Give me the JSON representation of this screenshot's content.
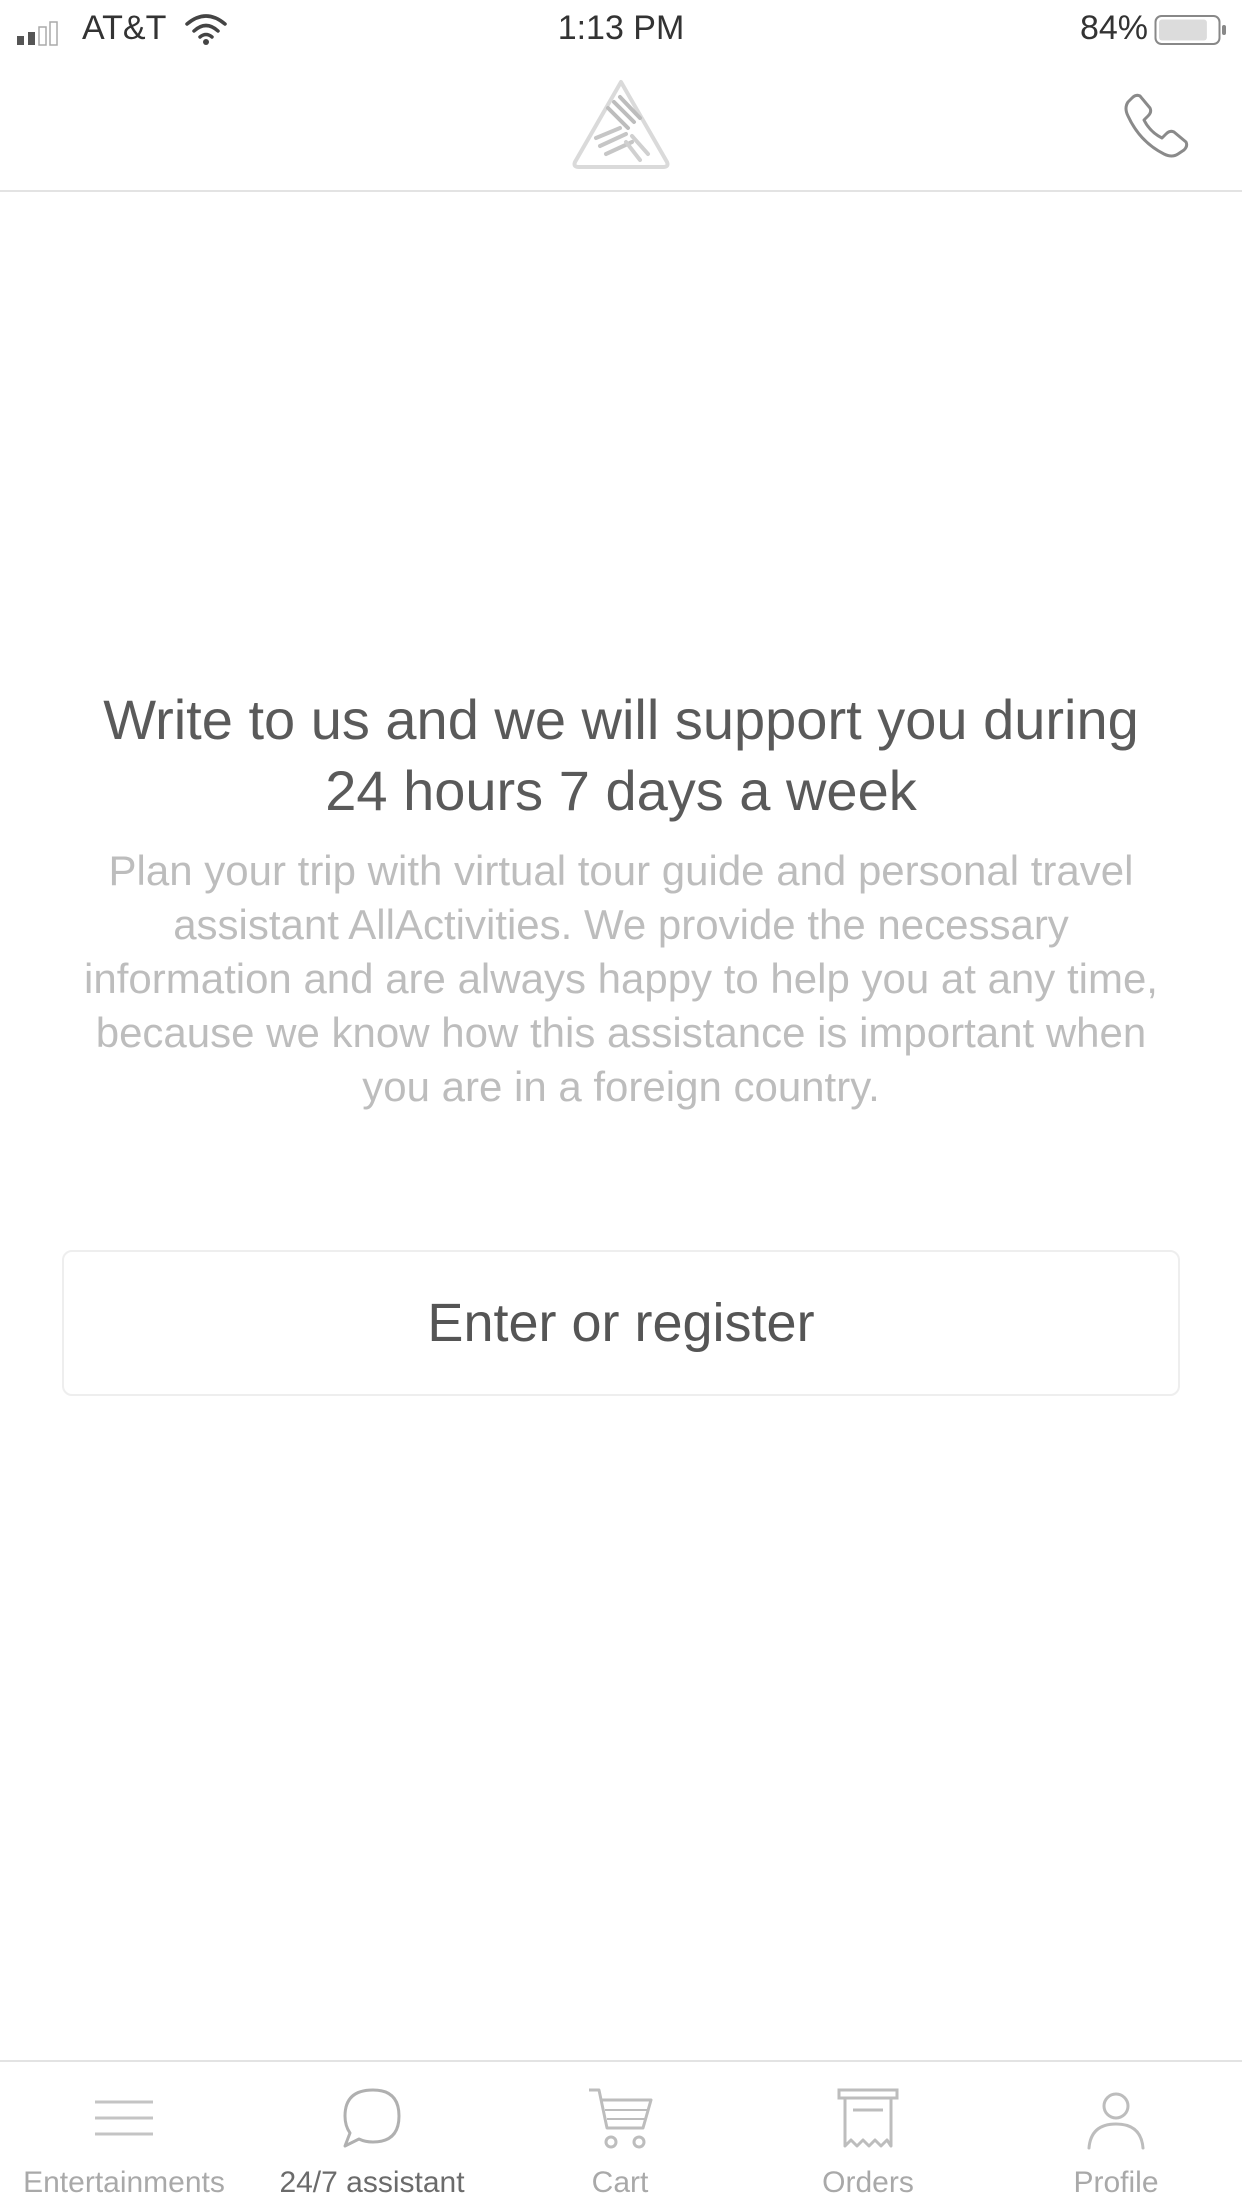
{
  "status_bar": {
    "carrier": "AT&T",
    "time": "1:13 PM",
    "battery_percent": "84%",
    "battery_level": 0.84
  },
  "header": {
    "logo_icon": "allactivities-logo-icon",
    "call_icon": "phone-icon"
  },
  "main": {
    "headline": "Write to us and we will support you during 24 hours 7 days a week",
    "description": "Plan your trip with virtual tour guide and personal travel assistant AllActivities. We provide the necessary information and are always happy to help you at any time, because we know how this assistance is important when you are in a foreign country.",
    "enter_button_label": "Enter or register"
  },
  "tab_bar": {
    "active_index": 1,
    "items": [
      {
        "label": "Entertainments",
        "icon": "menu-icon"
      },
      {
        "label": "24/7 assistant",
        "icon": "chat-bubble-icon"
      },
      {
        "label": "Cart",
        "icon": "cart-icon"
      },
      {
        "label": "Orders",
        "icon": "receipt-icon"
      },
      {
        "label": "Profile",
        "icon": "person-icon"
      }
    ]
  },
  "colors": {
    "headline": "#5a5a5a",
    "description": "#bdbdbd",
    "icon_gray": "#b5b5b5",
    "divider": "#e3e3e3"
  }
}
